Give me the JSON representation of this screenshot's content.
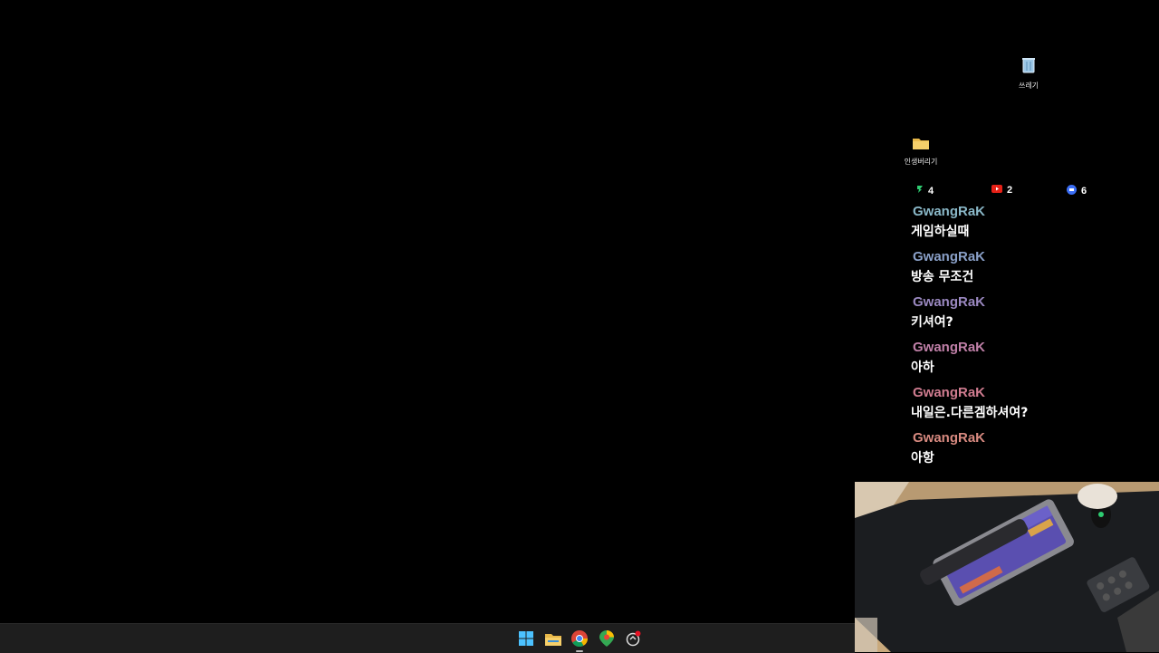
{
  "desktop": {
    "icons": [
      {
        "label": "쓰레기",
        "icon": "recycle-bin-icon"
      },
      {
        "label": "인생버리기",
        "icon": "folder-icon"
      }
    ]
  },
  "viewers": {
    "twitch": {
      "count": "4",
      "icon": "twitch-icon"
    },
    "youtube": {
      "count": "2",
      "icon": "youtube-icon"
    },
    "other": {
      "count": "6",
      "icon": "platform-icon"
    }
  },
  "chat": {
    "messages": [
      {
        "user": "GwangRaK",
        "text": "게임하실때",
        "color": "#8ab8c8"
      },
      {
        "user": "GwangRaK",
        "text": "방송 무조건",
        "color": "#8aa0c8"
      },
      {
        "user": "GwangRaK",
        "text": "키셔여?",
        "color": "#9a88c0"
      },
      {
        "user": "GwangRaK",
        "text": "아하",
        "color": "#c080a8"
      },
      {
        "user": "GwangRaK",
        "text": "내일은.다른겜하셔여?",
        "color": "#d07c90"
      },
      {
        "user": "GwangRaK",
        "text": "아항",
        "color": "#d88a80"
      }
    ]
  },
  "taskbar": {
    "items": [
      "start-icon",
      "file-explorer-icon",
      "chrome-icon",
      "maps-icon",
      "app-icon"
    ]
  }
}
